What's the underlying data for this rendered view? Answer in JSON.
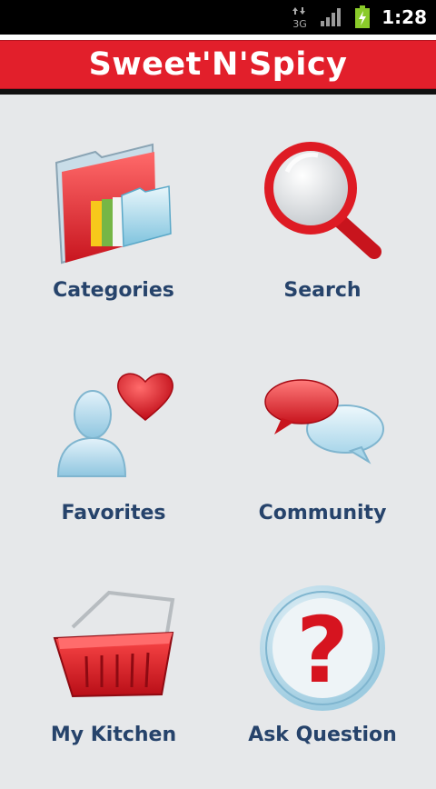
{
  "status_bar": {
    "time": "1:28",
    "network_label": "3G",
    "icons": [
      "data-3g-icon",
      "signal-icon",
      "battery-charging-icon"
    ]
  },
  "header": {
    "title": "Sweet'N'Spicy"
  },
  "menu": {
    "items": [
      {
        "label": "Categories",
        "icon": "folder-icon"
      },
      {
        "label": "Search",
        "icon": "magnifier-icon"
      },
      {
        "label": "Favorites",
        "icon": "user-heart-icon"
      },
      {
        "label": "Community",
        "icon": "chat-bubbles-icon"
      },
      {
        "label": "My Kitchen",
        "icon": "basket-icon"
      },
      {
        "label": "Ask Question",
        "icon": "question-mark-icon"
      }
    ]
  },
  "colors": {
    "header_red": "#e21f2b",
    "label_blue": "#26436b",
    "background": "#e6e8ea"
  }
}
